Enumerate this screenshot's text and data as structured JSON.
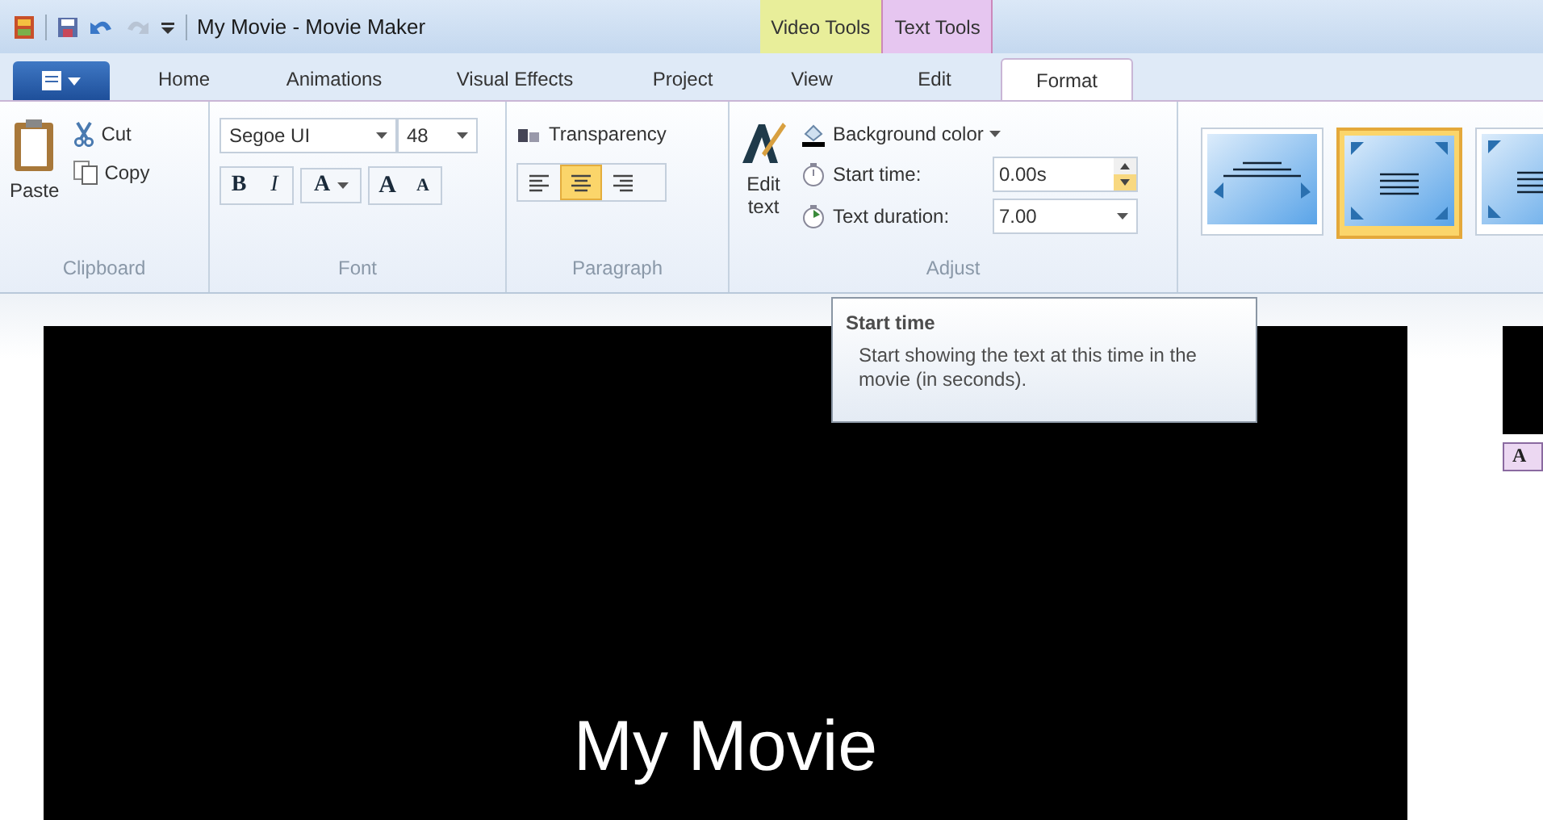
{
  "title_bar": {
    "title": "My Movie - Movie Maker"
  },
  "contextual_tabs": [
    {
      "label": "Video Tools",
      "color": "#e8ee9a"
    },
    {
      "label": "Text Tools",
      "color": "#e6c6f0"
    }
  ],
  "tabs": [
    {
      "label": "Home",
      "selected": false
    },
    {
      "label": "Animations",
      "selected": false
    },
    {
      "label": "Visual Effects",
      "selected": false
    },
    {
      "label": "Project",
      "selected": false
    },
    {
      "label": "View",
      "selected": false
    },
    {
      "label": "Edit",
      "selected": false
    },
    {
      "label": "Format",
      "selected": true
    }
  ],
  "clipboard": {
    "label": "Clipboard",
    "paste": "Paste",
    "cut": "Cut",
    "copy": "Copy"
  },
  "font": {
    "label": "Font",
    "family": "Segoe UI",
    "size": "48",
    "bold": "B",
    "italic": "I",
    "font_color": "A",
    "grow": "A",
    "shrink": "A"
  },
  "paragraph": {
    "label": "Paragraph",
    "transparency": "Transparency",
    "alignments": [
      {
        "kind": "left",
        "selected": false
      },
      {
        "kind": "center",
        "selected": true
      },
      {
        "kind": "right",
        "selected": false
      }
    ]
  },
  "adjust": {
    "label": "Adjust",
    "edit_text": "Edit text",
    "background_color": "Background color",
    "start_time": {
      "label": "Start time:",
      "value": "0.00s"
    },
    "text_duration": {
      "label": "Text duration:",
      "value": "7.00"
    }
  },
  "effects": [
    {
      "kind": "spread",
      "selected": false
    },
    {
      "kind": "expand",
      "selected": true
    },
    {
      "kind": "expand",
      "selected": false
    }
  ],
  "tooltip": {
    "title": "Start time",
    "text": "Start showing the text at this time in the movie (in seconds)."
  },
  "preview": {
    "caption": "My Movie"
  },
  "storyboard": {
    "caption_marker": "A"
  }
}
